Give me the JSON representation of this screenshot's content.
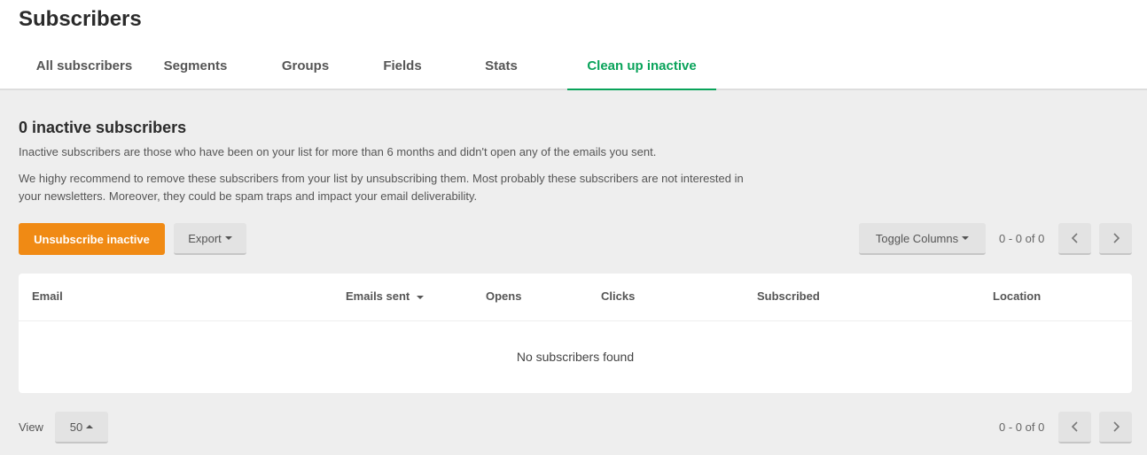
{
  "header": {
    "title": "Subscribers",
    "tabs": [
      {
        "label": "All subscribers"
      },
      {
        "label": "Segments"
      },
      {
        "label": "Groups"
      },
      {
        "label": "Fields"
      },
      {
        "label": "Stats"
      },
      {
        "label": "Clean up inactive",
        "active": true
      }
    ]
  },
  "main": {
    "heading": "0 inactive subscribers",
    "description_1": "Inactive subscribers are those who have been on your list for more than 6 months and didn't open any of the emails you sent.",
    "description_2": "We highy recommend to remove these subscribers from your list by unsubscribing them. Most probably these subscribers are not interested in your newsletters. Moreover, they could be spam traps and impact your email deliverability.",
    "unsubscribe_label": "Unsubscribe inactive",
    "export_label": "Export",
    "toggle_columns_label": "Toggle Columns",
    "pagination_top": "0 - 0 of 0",
    "pagination_bottom": "0 - 0 of 0",
    "table": {
      "columns": [
        "Email",
        "Emails sent",
        "Opens",
        "Clicks",
        "Subscribed",
        "Location"
      ],
      "empty_text": "No subscribers found"
    },
    "view_label": "View",
    "page_size": "50"
  },
  "colors": {
    "accent_green": "#09a35a",
    "primary_orange": "#f08a14"
  }
}
